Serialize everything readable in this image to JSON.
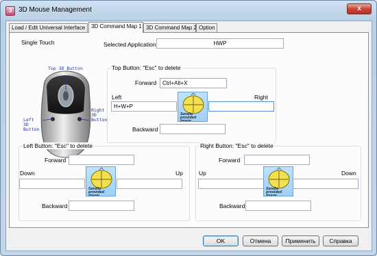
{
  "window": {
    "title": "3D Mouse Management",
    "icon_letter": "3",
    "close_symbol": "x"
  },
  "tabs": [
    {
      "label": "Load / Edit Universal Interface"
    },
    {
      "label": "3D Command Map 1"
    },
    {
      "label": "3D Command Map 2"
    },
    {
      "label": "Option"
    }
  ],
  "single_touch": "Single Touch",
  "selected_application": {
    "label": "Selected Application",
    "value": "HWP"
  },
  "mouse_labels": {
    "top": "Top 3D Button",
    "left": [
      "Left",
      "3D",
      "Button"
    ],
    "right": [
      "Right",
      "3D",
      "Button"
    ]
  },
  "top_group": {
    "title": "Top Button: \"Esc\" to delete",
    "forward_label": "Forward",
    "forward_value": "Ctrl+Alt+X",
    "left_label": "Left",
    "left_value": "H+W+P",
    "right_label": "Right",
    "right_value": "",
    "backward_label": "Backward",
    "backward_value": ""
  },
  "left_group": {
    "title": "Left Button: \"Esc\" to delete",
    "forward_label": "Forward",
    "forward_value": "",
    "down_label": "Down",
    "down_value": "",
    "up_label": "Up",
    "up_value": "",
    "backward_label": "Backward",
    "backward_value": ""
  },
  "right_group": {
    "title": "Right Button: \"Esc\" to delete",
    "forward_label": "Forward",
    "forward_value": "",
    "up_label": "Up",
    "up_value": "",
    "down_label": "Down",
    "down_value": "",
    "backward_label": "Backward",
    "backward_value": ""
  },
  "preview_caption": [
    "Sandia",
    "provided",
    "image"
  ],
  "buttons": {
    "ok": "OK",
    "cancel": "Отмена",
    "apply": "Применить",
    "help": "Справка"
  },
  "colors": {
    "accent": "#3c7fb1",
    "focus_border": "#4f8fd1",
    "mouse_label": "#1c2fa8"
  }
}
